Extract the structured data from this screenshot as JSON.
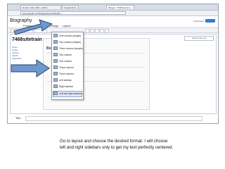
{
  "browser": {
    "tabs": [
      "Gmail - Inbox (58) - scribd...",
      "Google Drive",
      "Blogger: 7468sitetrainin..."
    ],
    "url": "www.google.com/blogger/layout?blogID=..."
  },
  "blog": {
    "title": "Biography",
    "dashboard_link": "Dashboard",
    "subtabs": [
      "Posting",
      "Settings",
      "Design",
      "Layout"
    ],
    "site_heading": "7468sitetrain",
    "sidebar_words": [
      "Posts",
      "Profile",
      "Archive",
      "Labels",
      "Subscribe"
    ],
    "search_label": "Search this site",
    "footer_label": "Title"
  },
  "layout_menu": {
    "items": [
      "One column (simple)",
      "Two column (simple)",
      "Three column (simple)",
      "Two column",
      "Two column",
      "Three column",
      "Three column",
      "Left sidebar",
      "Right sidebar",
      "Left and right sidebars"
    ],
    "selected_index": 9
  },
  "caption": {
    "line1": "Go to layout and choose the desired format.  I will choose",
    "line2": "left and right sidebars only to get my text perfectly centered."
  },
  "colors": {
    "arrow_fill": "#6f97cf",
    "arrow_stroke": "#27466f",
    "accent": "#2f7fd6"
  }
}
